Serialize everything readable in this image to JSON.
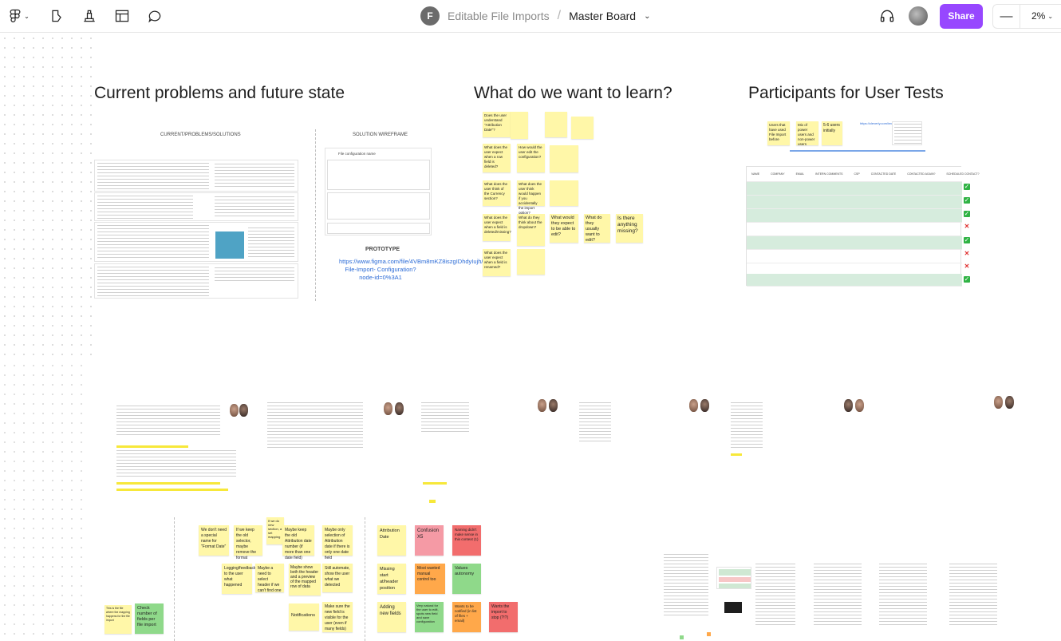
{
  "topbar": {
    "project": "Editable File Imports",
    "separator": "/",
    "file": "Master Board",
    "project_initial": "F",
    "share": "Share",
    "zoom": "2%",
    "zoom_minus": "—"
  },
  "sections": {
    "problems_title": "Current problems and future state",
    "learn_title": "What do we want to learn?",
    "participants_title": "Participants for User Tests"
  },
  "problems": {
    "current_label": "CURRENT/PROBLEMS/SOLUTIONS",
    "wire_label": "SOLUTION WIREFRAME",
    "wire_header": "File configuration name",
    "prototype_label": "PROTOTYPE",
    "prototype_link": "https://www.figma.com/file/4VBm8mKZ8iszgIDhdyIujh/New- File-Import- Configuration? node-id=0%3A1"
  },
  "learn_stickies": [
    "Does the user understand \"Attribution Date\"?",
    "What does the user expect when a row field is deleted?",
    "What does the user think of the Currency section?",
    "What does the user expect when a field is deleted/missing?",
    "What does the user expect when a field is renamed?",
    "How would the user edit the configuration?",
    "What does the user think would happen if you accidentally the import option?",
    "What do they think about the dropdown?",
    "What would they expect to be able to edit?",
    "What do they usually want to edit?",
    "Is there anything missing?"
  ],
  "participants": {
    "stickies": [
      "Users that have used File Import before",
      "Mix of power users and non-power users",
      "5-6 users initially"
    ],
    "link_note": "https://cleverly.com/invited/...",
    "table_headers": [
      "NAME",
      "COMPANY",
      "EMAIL",
      "",
      "INTERN COMMENTS",
      "CSP",
      "CONTACTED DATE",
      "CONTACTED AGAIN?",
      "SCHEDULED CONTACT?"
    ],
    "statuses": [
      "ok",
      "ok",
      "ok",
      "no",
      "ok",
      "no",
      "no",
      "ok"
    ]
  },
  "synthesis": {
    "col1": [
      "We don't need a special name for \"Format Date\"",
      "Logging/feedback to the user what happened"
    ],
    "col2": [
      "If we keep the old selector, maybe remove the format",
      "Maybe a need to select header if we can't find one"
    ],
    "col3": [
      "If we do new section, a set mapping",
      "Maybe keep the old Attribution date number (if more than one date field)",
      "Maybe show both the header and a preview of the mapped row of data"
    ],
    "col4": [
      "Maybe only selection of Attribution date if there is only one date field",
      "Still automate, show the user what we detected",
      "Make sure the new field is visible for the user (even if many fields)"
    ],
    "notifications": "Notifications",
    "sticky_left": "This is the file where the mapping happens for the file import",
    "check": "Check number of fields per file import"
  },
  "clusters": {
    "attribution": "Attribution Date",
    "missing": "Missing start at/header position",
    "adding": "Adding new fields",
    "adding_sub": "Very natural for the user to edit, spots new field and save configuration",
    "confusion": "Confusion X5",
    "naming": "Naming didn't make sense in this context (1)",
    "most_wanted": "Most wanted manual control too",
    "values": "Values autonomy",
    "wants_notified": "Wants to be notified (in list of files + email)",
    "wants_stop": "Wants the import to stop (?!?)"
  },
  "colors": {
    "accent": "#9747ff",
    "sticky_yellow": "#fff7a8",
    "sticky_pink": "#f59aa5",
    "sticky_orange": "#ffa84a",
    "sticky_green": "#8fd98a",
    "sticky_red": "#f26d6d"
  }
}
